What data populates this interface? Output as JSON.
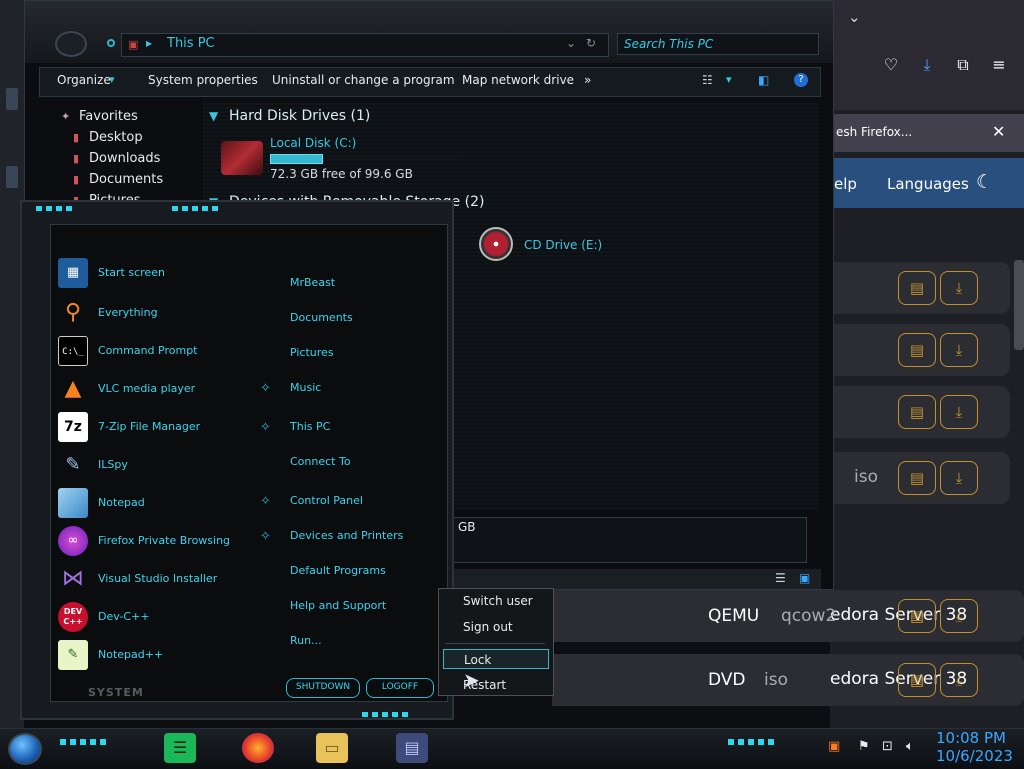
{
  "browser": {
    "notification_text": "esh Firefox...",
    "nav": {
      "help": "elp",
      "languages": "Languages"
    },
    "rows": [
      {
        "text": ""
      },
      {
        "text": ""
      },
      {
        "text": ""
      },
      {
        "text": "iso"
      },
      {
        "text_a": "edora Server 38",
        "text_b": "QEMU",
        "text_c": "qcow2"
      },
      {
        "text_a": "edora Server 38",
        "text_b": "DVD",
        "text_c": "iso"
      }
    ]
  },
  "explorer": {
    "address": "This PC",
    "search_placeholder": "Search This PC",
    "toolbar": {
      "organize": "Organize",
      "system_properties": "System properties",
      "uninstall": "Uninstall or change a program",
      "map_drive": "Map network drive",
      "more": "»"
    },
    "nav": {
      "favorites": "Favorites",
      "desktop": "Desktop",
      "downloads": "Downloads",
      "documents": "Documents",
      "pictures": "Pictures"
    },
    "groups": {
      "hard_disks": "Hard Disk Drives (1)",
      "removable": "Devices with Removable Storage (2)"
    },
    "local_disk": {
      "name": "Local Disk (C:)",
      "free": "72.3 GB free of 99.6 GB",
      "used_fraction": 0.27
    },
    "cd_drive": {
      "name": "CD Drive (E:)"
    },
    "details_text": "GB"
  },
  "start_menu": {
    "left_items": [
      {
        "label": "Start screen",
        "icon": "start-screen-icon"
      },
      {
        "label": "Everything",
        "icon": "search-magnifier-icon"
      },
      {
        "label": "Command Prompt",
        "icon": "terminal-icon"
      },
      {
        "label": "VLC media player",
        "icon": "vlc-cone-icon"
      },
      {
        "label": "7-Zip File Manager",
        "icon": "7zip-icon",
        "icon_text": "7z"
      },
      {
        "label": "ILSpy",
        "icon": "ilspy-icon"
      },
      {
        "label": "Notepad",
        "icon": "notepad-icon"
      },
      {
        "label": "Firefox Private Browsing",
        "icon": "firefox-private-icon"
      },
      {
        "label": "Visual Studio Installer",
        "icon": "visual-studio-icon"
      },
      {
        "label": "Dev-C++",
        "icon": "devcpp-icon",
        "icon_text": "DEV C++"
      },
      {
        "label": "Notepad++",
        "icon": "notepadpp-icon"
      }
    ],
    "right_items": [
      {
        "label": "MrBeast"
      },
      {
        "label": "Documents"
      },
      {
        "label": "Pictures"
      },
      {
        "label": "Music"
      },
      {
        "label": "This PC"
      },
      {
        "label": "Connect To"
      },
      {
        "label": "Control Panel"
      },
      {
        "label": "Devices and Printers"
      },
      {
        "label": "Default Programs"
      },
      {
        "label": "Help and Support"
      },
      {
        "label": "Run..."
      }
    ],
    "shutdown": "SHUTDOWN",
    "logoff": "LOGOFF",
    "system_label": "SYSTEM"
  },
  "power_menu": {
    "items": [
      "Switch user",
      "Sign out",
      "Lock",
      "Restart"
    ],
    "selected": "Lock"
  },
  "taskbar": {
    "time": "10:08 PM",
    "date": "10/6/2023"
  },
  "colors": {
    "accent": "#3ad4ee",
    "browser_nav": "#294f7f",
    "browser_button": "#c4922d"
  }
}
